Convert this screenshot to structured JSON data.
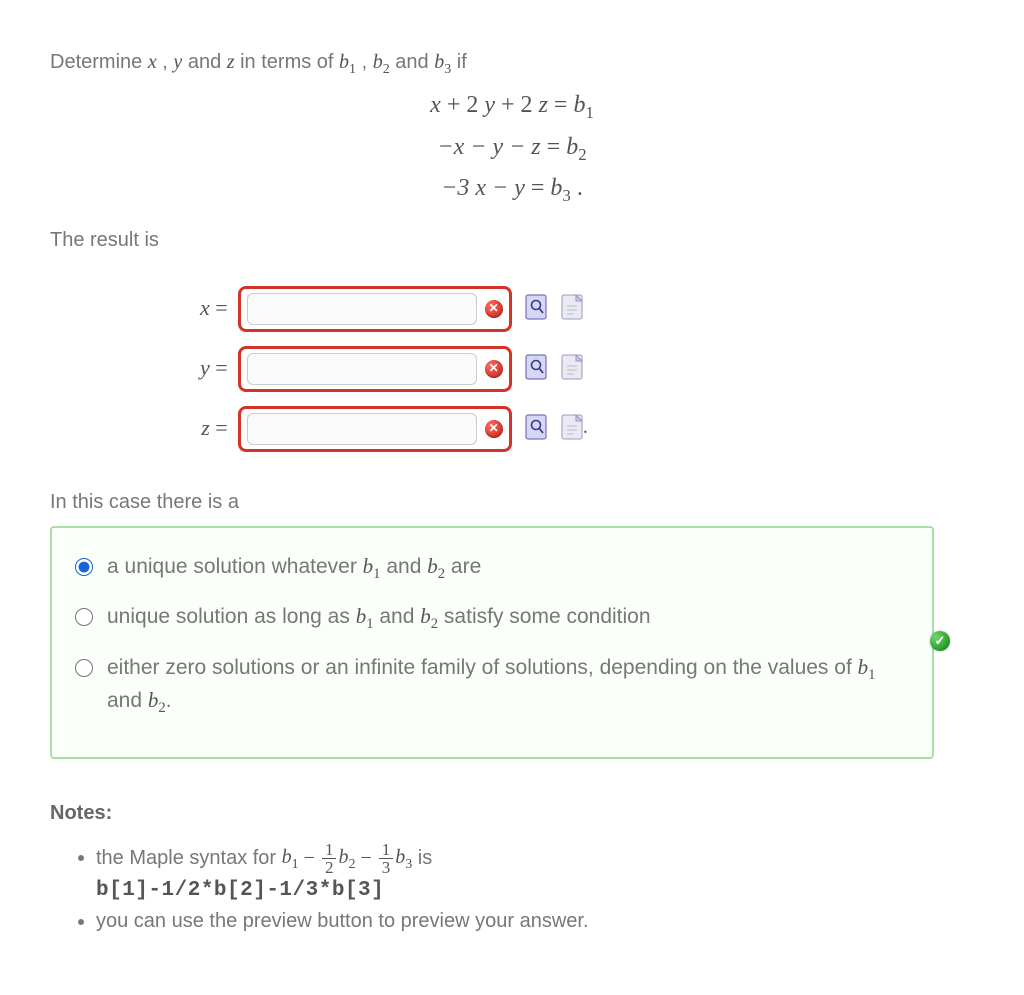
{
  "prompt": {
    "prefix": "Determine ",
    "x": "x",
    "comma1": " , ",
    "y": "y",
    "and1": " and ",
    "z": "z",
    "middle": " in terms of ",
    "b1": "b",
    "b1sub": "1",
    "comma2": " , ",
    "b2": "b",
    "b2sub": "2",
    "and2": " and ",
    "b3": "b",
    "b3sub": "3",
    "suffix": " if"
  },
  "equations": {
    "line1": {
      "lhs_terms": [
        {
          "t": "x"
        },
        {
          "t": " + 2 "
        },
        {
          "t": "y"
        },
        {
          "t": " + 2 "
        },
        {
          "t": "z"
        }
      ],
      "eq": " = ",
      "rhs": "b",
      "rsub": "1"
    },
    "line2": {
      "lhs": "−x − y − z",
      "eq": " = ",
      "rhs": "b",
      "rsub": "2"
    },
    "line3": {
      "lhs": "−3 x − y",
      "eq": " = ",
      "rhs": "b",
      "rsub": "3",
      "tail": " ."
    }
  },
  "result_label": "The result is",
  "answers": [
    {
      "var": "x",
      "eq": " = "
    },
    {
      "var": "y",
      "eq": " = "
    },
    {
      "var": "z",
      "eq": " = "
    }
  ],
  "icons": {
    "wrong": "✕",
    "ok": "✓"
  },
  "case_label": "In this case there is a",
  "radio": {
    "opt1": {
      "pre": "a unique solution whatever ",
      "b1": "b",
      "b1s": "1",
      " and_": " and ",
      "b2": "b",
      "b2s": "2",
      " post": " are"
    },
    "opt2": {
      "pre": "unique solution as long as ",
      "b1": "b",
      "b1s": "1",
      " and_": " and ",
      "b2": "b",
      "b2s": "2",
      " post": " satisfy some condition"
    },
    "opt3": {
      "pre": "either zero solutions or an infinite family of solutions, depending on the values of ",
      "b1": "b",
      "b1s": "1",
      " and_": " and ",
      "b2": "b",
      "b2s": "2",
      " post": "."
    },
    "selected_index": 0
  },
  "notes": {
    "header": "Notes:",
    "li1": {
      "pre": "the Maple syntax for ",
      "b1": "b",
      "b1s": "1",
      "minus1": " − ",
      "f1num": "1",
      "f1den": "2",
      "b2": "b",
      "b2s": "2",
      "minus2": " − ",
      "f2num": "1",
      "f2den": "3",
      "b3": "b",
      "b3s": "3",
      "post": " is"
    },
    "code": "b[1]-1/2*b[2]-1/3*b[3]",
    "li2": "you can use the preview button to preview your answer."
  },
  "trailing_period": "."
}
